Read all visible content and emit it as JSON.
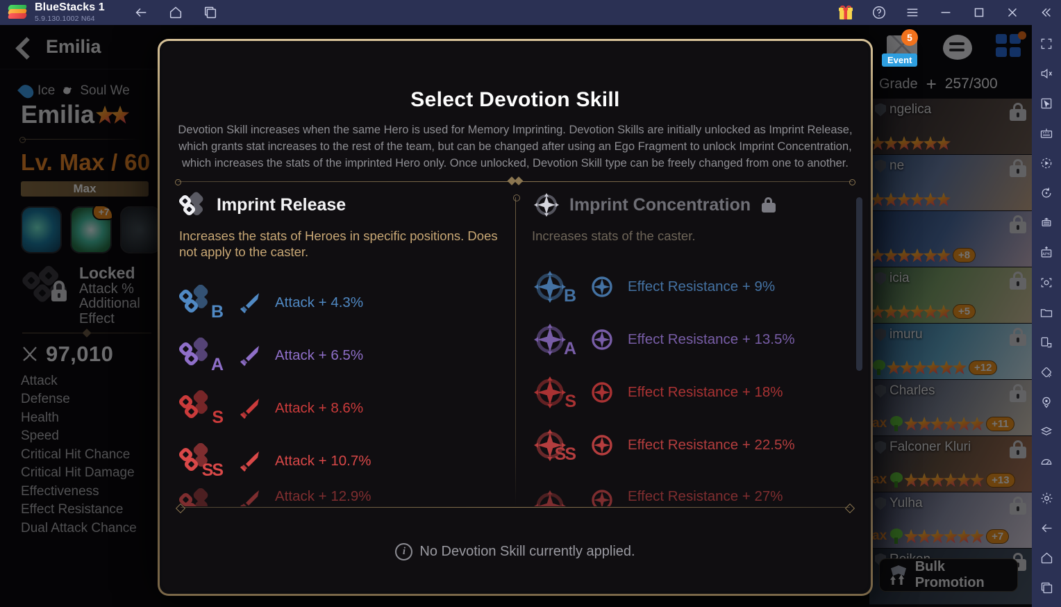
{
  "titlebar": {
    "app_name": "BlueStacks 1",
    "version": "5.9.130.1002  N64",
    "nav": [
      {
        "name": "back-icon",
        "label": "Back"
      },
      {
        "name": "home-icon",
        "label": "Home"
      },
      {
        "name": "multi-instance-icon",
        "label": "Multi-instance"
      }
    ],
    "right_icons": [
      {
        "name": "gift-icon",
        "label": "Gifts"
      },
      {
        "name": "help-icon",
        "label": "Help"
      },
      {
        "name": "menu-icon",
        "label": "Menu"
      },
      {
        "name": "minimize-icon",
        "label": "Minimize"
      },
      {
        "name": "maximize-icon",
        "label": "Maximize"
      },
      {
        "name": "close-icon",
        "label": "Close"
      },
      {
        "name": "collapse-sidebar-icon",
        "label": "Collapse"
      }
    ]
  },
  "left_panel": {
    "back_label": "Emilia",
    "element": "Ice",
    "class": "Soul We",
    "hero_name": "Emilia",
    "level": "Lv. Max / 60",
    "level_bar_label": "Max",
    "skill_plus_badge": "+7",
    "locked_title": "Locked",
    "locked_desc_line1": "Attack %",
    "locked_desc_line2": "Additional",
    "locked_desc_line3": "Effect",
    "power_value": "97,010",
    "stats": [
      "Attack",
      "Defense",
      "Health",
      "Speed",
      "Critical Hit Chance",
      "Critical Hit Damage",
      "Effectiveness",
      "Effect Resistance",
      "Dual Attack Chance"
    ]
  },
  "right_panel": {
    "mail_badge": "5",
    "event_label": "Event",
    "grade_label": "Grade",
    "grade_count": "257/300",
    "bulk_promotion_label": "Bulk Promotion",
    "heroes": [
      {
        "name": "ngelica",
        "max": "",
        "stars": 6,
        "plus": "",
        "locked": true,
        "tree": false,
        "art": "linear-gradient(120deg,#2d2a33,#4a3f3c 45%,#6b5b52)"
      },
      {
        "name": "ne",
        "max": "",
        "stars": 6,
        "plus": "",
        "locked": true,
        "tree": false,
        "art": "linear-gradient(120deg,#2c4a72,#6a7fa8 40%,#c8a98c)"
      },
      {
        "name": "",
        "max": "",
        "stars": 6,
        "plus": "+8",
        "locked": true,
        "tree": false,
        "art": "linear-gradient(120deg,#24406e,#4d6ea3 45%,#cbb6c8)"
      },
      {
        "name": "icia",
        "max": "",
        "stars": 6,
        "plus": "+5",
        "locked": true,
        "tree": false,
        "art": "linear-gradient(120deg,#3a5c48,#7fa36b 40%,#d2c3a0)"
      },
      {
        "name": "imuru",
        "max": "",
        "stars": 6,
        "plus": "+12",
        "locked": true,
        "tree": true,
        "art": "linear-gradient(120deg,#2a5a86,#61a8c9 45%,#cfe6ef)"
      },
      {
        "name": "Charles",
        "max": "ax",
        "stars": 6,
        "plus": "+11",
        "locked": true,
        "tree": true,
        "art": "linear-gradient(120deg,#30364a,#7d8496 45%,#d9cfc0)"
      },
      {
        "name": "Falconer Kluri",
        "max": "ax",
        "stars": 6,
        "plus": "+13",
        "locked": true,
        "tree": true,
        "art": "linear-gradient(120deg,#2a3144,#6b5442 45%,#b0785a)"
      },
      {
        "name": "Yulha",
        "max": "ax",
        "stars": 6,
        "plus": "+7",
        "locked": true,
        "tree": true,
        "art": "linear-gradient(120deg,#2f3550,#8e92ab 45%,#ddd4e2)"
      },
      {
        "name": "Reiken",
        "max": "",
        "stars": 0,
        "plus": "",
        "locked": true,
        "tree": false,
        "art": "linear-gradient(120deg,#26303f,#4a5768)"
      }
    ]
  },
  "modal": {
    "title": "Select Devotion Skill",
    "description": "Devotion Skill increases when the same Hero is used for Memory Imprinting. Devotion Skills are initially unlocked as Imprint Release, which grants stat increases to the rest of the team, but can be changed after using an Ego Fragment to unlock Imprint Concentration, which increases the stats of the imprinted Hero only. Once unlocked, Devotion Skill type can be freely changed from one to another.",
    "footer_note": "No Devotion Skill currently applied.",
    "columns": [
      {
        "id": "imprint-release",
        "title": "Imprint Release",
        "locked": false,
        "subtitle": "Increases the stats of Heroes in specific positions. Does not apply to the caster.",
        "rows": [
          {
            "grade": "B",
            "stat": "Attack",
            "value": "+ 4.3%",
            "text": "Attack + 4.3%",
            "color": "#5089c4"
          },
          {
            "grade": "A",
            "stat": "Attack",
            "value": "+ 6.5%",
            "text": "Attack + 6.5%",
            "color": "#8f6fc9"
          },
          {
            "grade": "S",
            "stat": "Attack",
            "value": "+ 8.6%",
            "text": "Attack + 8.6%",
            "color": "#cb3b3b"
          },
          {
            "grade": "SS",
            "stat": "Attack",
            "value": "+ 10.7%",
            "text": "Attack + 10.7%",
            "color": "#d94848"
          }
        ]
      },
      {
        "id": "imprint-concentration",
        "title": "Imprint Concentration",
        "locked": true,
        "subtitle": "Increases stats of the caster.",
        "rows": [
          {
            "grade": "B",
            "stat": "Effect Resistance",
            "value": "+ 9%",
            "text": "Effect Resistance + 9%",
            "color": "#5089c4"
          },
          {
            "grade": "A",
            "stat": "Effect Resistance",
            "value": "+ 13.5%",
            "text": "Effect Resistance + 13.5%",
            "color": "#8f6fc9"
          },
          {
            "grade": "S",
            "stat": "Effect Resistance",
            "value": "+ 18%",
            "text": "Effect Resistance + 18%",
            "color": "#cb3b3b"
          },
          {
            "grade": "SS",
            "stat": "Effect Resistance",
            "value": "+ 22.5%",
            "text": "Effect Resistance + 22.5%",
            "color": "#d94848"
          }
        ]
      }
    ]
  },
  "bs_sidebar": {
    "items": [
      {
        "name": "fullscreen-icon"
      },
      {
        "name": "mute-icon"
      },
      {
        "name": "cursor-icon"
      },
      {
        "name": "keyboard-controls-icon"
      },
      {
        "name": "macro-record-icon"
      },
      {
        "name": "sync-icon"
      },
      {
        "name": "multi-instance-sync-icon"
      },
      {
        "name": "install-apk-icon"
      },
      {
        "name": "screenshot-icon"
      },
      {
        "name": "media-folder-icon"
      },
      {
        "name": "rotate-icon"
      },
      {
        "name": "shake-icon"
      },
      {
        "name": "location-icon"
      },
      {
        "name": "layers-icon"
      },
      {
        "name": "performance-icon"
      },
      {
        "name": "settings-icon"
      },
      {
        "name": "back-icon"
      },
      {
        "name": "home-icon"
      },
      {
        "name": "recents-icon"
      }
    ]
  },
  "colors": {
    "accent_gold": "#8a7550",
    "grade_b": "#5089c4",
    "grade_a": "#8f6fc9",
    "grade_s": "#cb3b3b",
    "grade_ss": "#d94848",
    "bs_chrome": "#2b3154",
    "level_orange": "#ef8b2a"
  }
}
